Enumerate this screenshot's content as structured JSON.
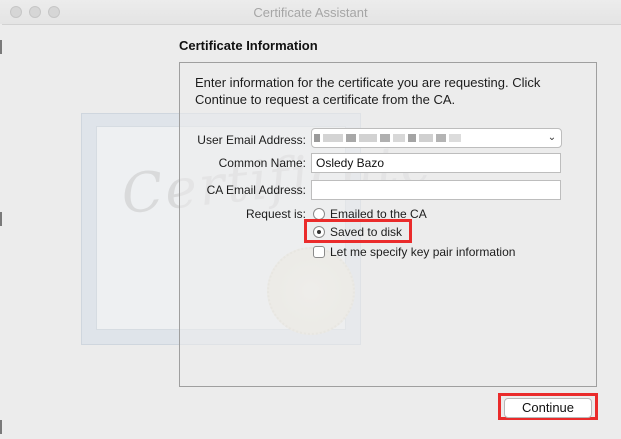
{
  "window": {
    "title": "Certificate Assistant"
  },
  "heading": "Certificate Information",
  "intro": "Enter information for the certificate you are requesting. Click Continue to request a certificate from the CA.",
  "form": {
    "user_email_label": "User Email Address:",
    "common_name_label": "Common Name:",
    "common_name_value": "Osledy Bazo",
    "ca_email_label": "CA Email Address:",
    "ca_email_value": "",
    "request_label": "Request is:",
    "options": {
      "emailed": "Emailed to the CA",
      "saved": "Saved to disk",
      "specify_key_pair": "Let me specify key pair information"
    },
    "selected_option": "saved",
    "specify_key_pair_checked": false
  },
  "buttons": {
    "continue": "Continue"
  },
  "background": {
    "certificate_word": "Certificate"
  },
  "colors": {
    "highlight": "#ea2b2b",
    "title_text": "#a6a6a6"
  }
}
